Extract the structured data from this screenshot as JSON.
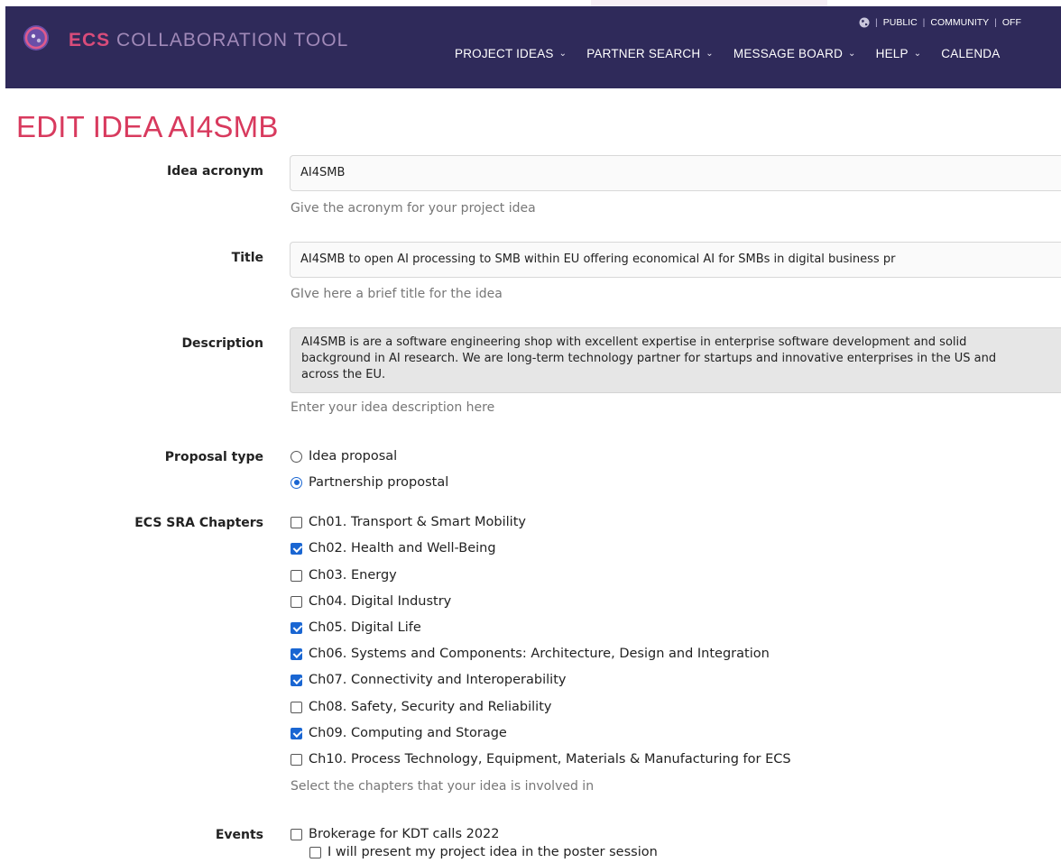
{
  "header": {
    "brand_bold": "ECS",
    "brand_rest": "COLLABORATION TOOL",
    "util": [
      "PUBLIC",
      "COMMUNITY",
      "OFF"
    ],
    "nav": [
      "PROJECT IDEAS",
      "PARTNER SEARCH",
      "MESSAGE BOARD",
      "HELP",
      "CALENDA"
    ],
    "colors": {
      "bar": "#2f2a5a",
      "accent": "#d94c7a",
      "brand_light": "#a089b8"
    }
  },
  "page": {
    "title": "EDIT IDEA AI4SMB",
    "title_color": "#d83a5e"
  },
  "form": {
    "acronym": {
      "label": "Idea acronym",
      "value": "AI4SMB",
      "help": "Give the acronym for your project idea"
    },
    "title": {
      "label": "Title",
      "value": "AI4SMB to open AI processing to SMB within EU offering economical AI for SMBs in digital business pr",
      "help": "GIve here a brief title for the idea"
    },
    "description": {
      "label": "Description",
      "lines": [
        "AI4SMB is are a software engineering shop with excellent expertise in enterprise software development and solid",
        "background in AI research. We are long-term technology partner for startups and innovative enterprises in the US and",
        "across the EU."
      ],
      "help": "Enter your idea description here"
    },
    "proposal_type": {
      "label": "Proposal type",
      "options": [
        {
          "label": "Idea proposal",
          "selected": false
        },
        {
          "label": "Partnership propostal",
          "selected": true
        }
      ]
    },
    "chapters": {
      "label": "ECS SRA Chapters",
      "options": [
        {
          "label": "Ch01. Transport & Smart Mobility",
          "checked": false
        },
        {
          "label": "Ch02. Health and Well-Being",
          "checked": true
        },
        {
          "label": "Ch03. Energy",
          "checked": false
        },
        {
          "label": "Ch04. Digital Industry",
          "checked": false
        },
        {
          "label": "Ch05. Digital Life",
          "checked": true
        },
        {
          "label": "Ch06. Systems and Components: Architecture, Design and Integration",
          "checked": true
        },
        {
          "label": "Ch07. Connectivity and Interoperability",
          "checked": true
        },
        {
          "label": "Ch08. Safety, Security and Reliability",
          "checked": false
        },
        {
          "label": "Ch09. Computing and Storage",
          "checked": true
        },
        {
          "label": "Ch10. Process Technology, Equipment, Materials & Manufacturing for ECS",
          "checked": false
        }
      ],
      "help": "Select the chapters that your idea is involved in"
    },
    "events": {
      "label": "Events",
      "options": [
        {
          "label": "Brokerage for KDT calls 2022",
          "checked": false
        },
        {
          "label": "I will present my project idea in the poster session",
          "checked": false
        }
      ]
    }
  }
}
